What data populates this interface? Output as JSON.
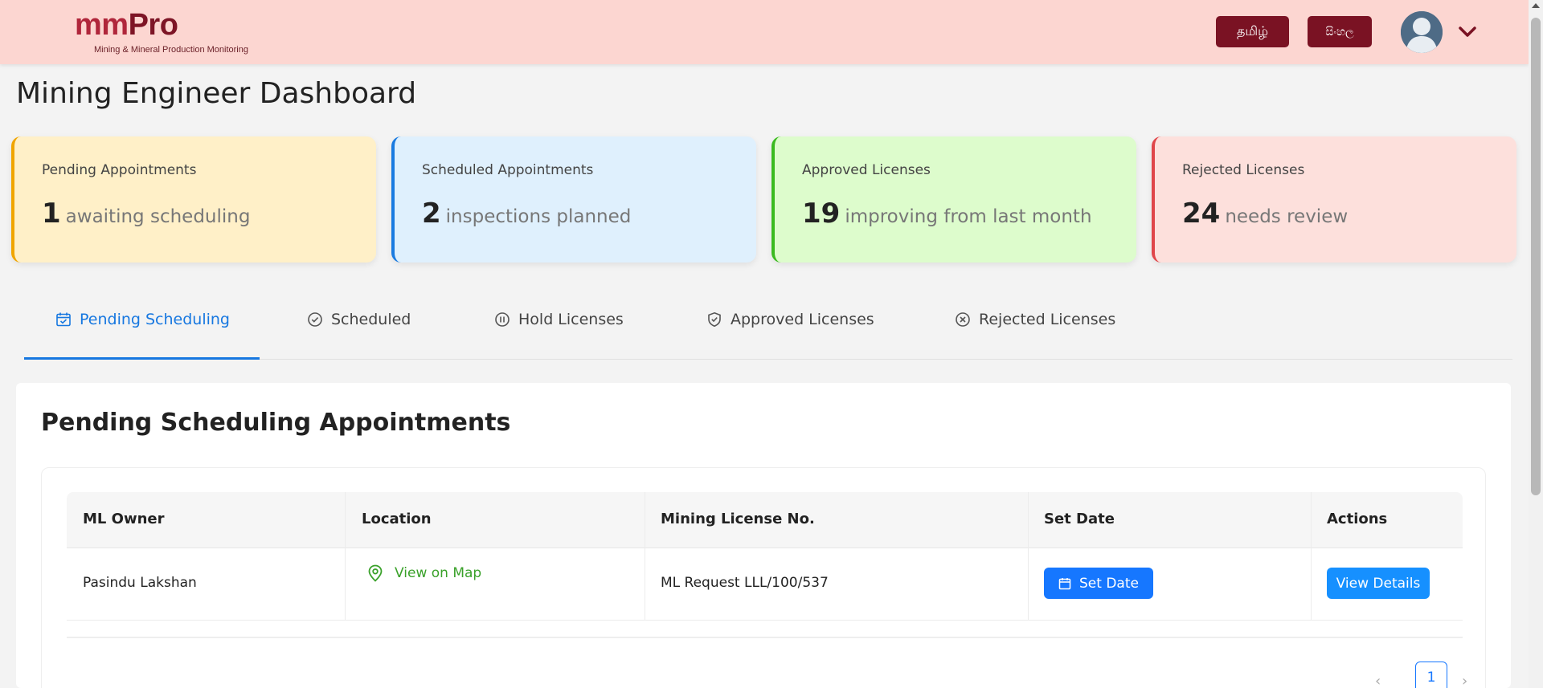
{
  "header": {
    "logo_main": "mm",
    "logo_pro": "Pro",
    "logo_subtitle": "Mining & Mineral Production Monitoring",
    "lang_tamil": "தமிழ்",
    "lang_sinhala": "සිංහල"
  },
  "page": {
    "title": "Mining Engineer Dashboard"
  },
  "cards": [
    {
      "label": "Pending Appointments",
      "value": "1",
      "desc": "awaiting scheduling",
      "accent": "#f0a500"
    },
    {
      "label": "Scheduled Appointments",
      "value": "2",
      "desc": "inspections planned",
      "accent": "#1a7be0"
    },
    {
      "label": "Approved Licenses",
      "value": "19",
      "desc": "improving from last month",
      "accent": "#3aba1f"
    },
    {
      "label": "Rejected Licenses",
      "value": "24",
      "desc": "needs review",
      "accent": "#e0464a"
    }
  ],
  "tabs": [
    {
      "label": "Pending Scheduling",
      "icon": "calendar-check-icon",
      "active": true
    },
    {
      "label": "Scheduled",
      "icon": "check-circle-icon"
    },
    {
      "label": "Hold Licenses",
      "icon": "pause-circle-icon"
    },
    {
      "label": "Approved Licenses",
      "icon": "shield-check-icon"
    },
    {
      "label": "Rejected Licenses",
      "icon": "x-circle-icon"
    }
  ],
  "panel": {
    "title": "Pending Scheduling Appointments"
  },
  "table": {
    "columns": [
      "ML Owner",
      "Location",
      "Mining License No.",
      "Set Date",
      "Actions"
    ],
    "rows": [
      {
        "owner": "Pasindu Lakshan",
        "location": "View on Map",
        "license": "ML Request LLL/100/537",
        "set_date": "Set Date",
        "action": "View Details"
      }
    ]
  },
  "pagination": {
    "current": "1",
    "prev": "‹",
    "next": "›"
  },
  "colors": {
    "accent": "#1677ff",
    "brand": "#7a1223",
    "header_bg": "#fcd6d1"
  }
}
